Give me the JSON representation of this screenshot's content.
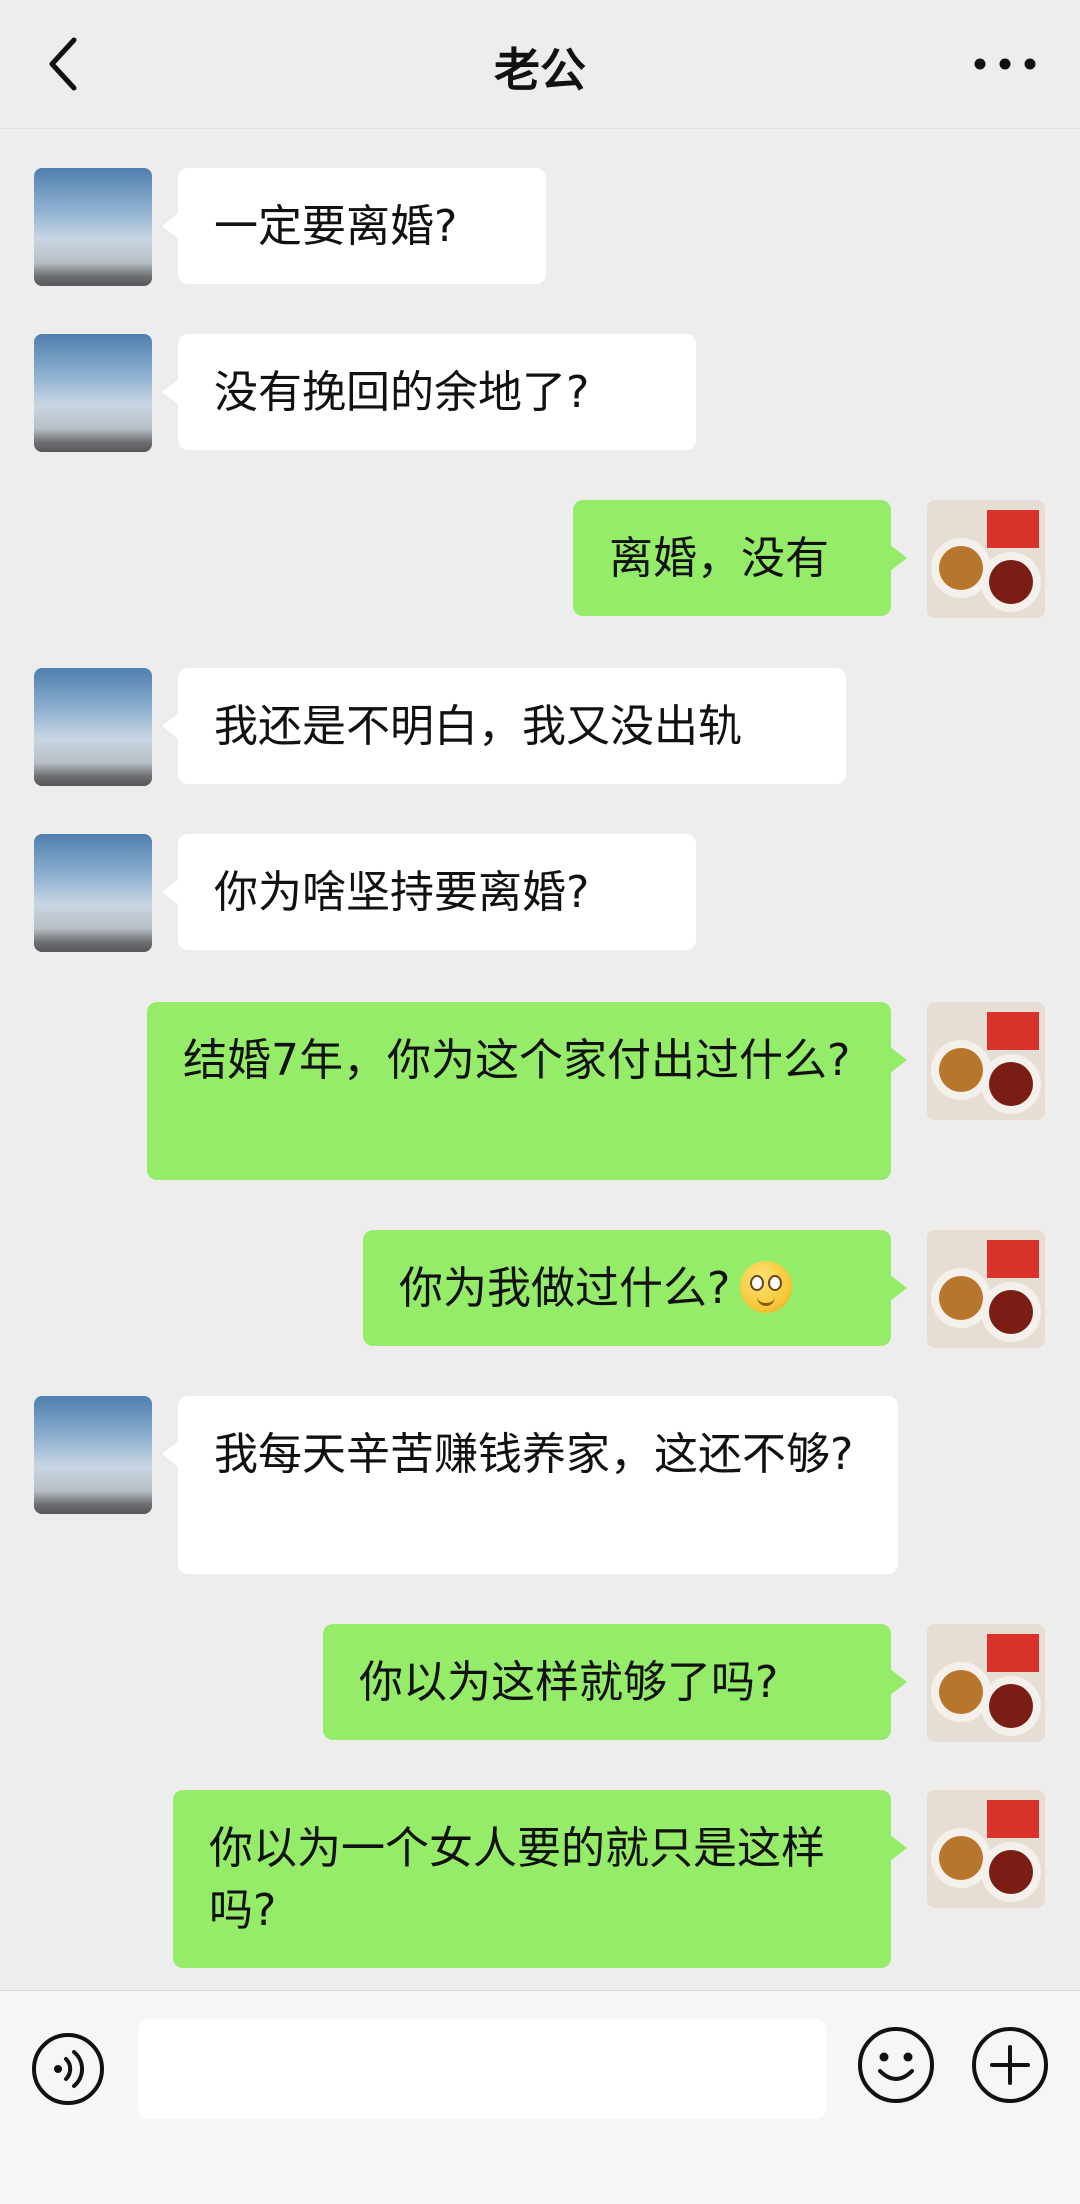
{
  "header": {
    "title": "老公",
    "back_icon": "chevron-left-icon",
    "more_icon": "ellipsis-icon"
  },
  "messages": [
    {
      "side": "left",
      "text": "一定要离婚?"
    },
    {
      "side": "left",
      "text": "没有挽回的余地了?"
    },
    {
      "side": "right",
      "text": "离婚，没有"
    },
    {
      "side": "left",
      "text": "我还是不明白，我又没出轨"
    },
    {
      "side": "left",
      "text": "你为啥坚持要离婚?"
    },
    {
      "side": "right",
      "text": "结婚7年，你为这个家付出过什么?"
    },
    {
      "side": "right",
      "text": "你为我做过什么?",
      "emoji": "smiling-face-icon"
    },
    {
      "side": "left",
      "text": "我每天辛苦赚钱养家，这还不够?"
    },
    {
      "side": "right",
      "text": "你以为这样就够了吗?"
    },
    {
      "side": "right",
      "text": "你以为一个女人要的就只是这样吗?"
    }
  ],
  "input_bar": {
    "placeholder": "",
    "voice_icon": "voice-icon",
    "emoji_icon": "emoji-icon",
    "plus_icon": "plus-icon"
  },
  "colors": {
    "background": "#ededed",
    "bubble_self": "#95ec69",
    "bubble_other": "#ffffff"
  }
}
